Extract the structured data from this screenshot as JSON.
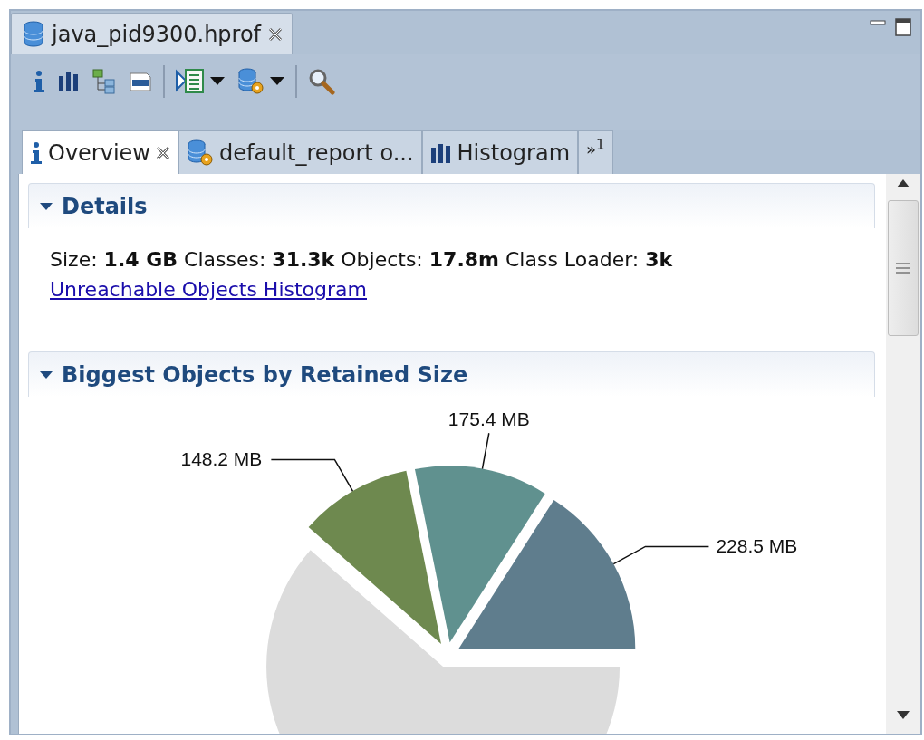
{
  "editor_tab": {
    "label": "java_pid9300.hprof"
  },
  "toolbar": [
    {
      "kind": "info"
    },
    {
      "kind": "histogram"
    },
    {
      "kind": "tree"
    },
    {
      "kind": "oql"
    },
    {
      "kind": "separator"
    },
    {
      "kind": "report",
      "dropdown": true
    },
    {
      "kind": "dbgear",
      "dropdown": true
    },
    {
      "kind": "separator"
    },
    {
      "kind": "search"
    }
  ],
  "tabs": [
    {
      "label": "Overview",
      "kind": "info",
      "selected": true,
      "closable": true
    },
    {
      "label": "default_report  o...",
      "kind": "dbgear",
      "selected": false,
      "closable": false
    },
    {
      "label": "Histogram",
      "kind": "histogram",
      "selected": false,
      "closable": false
    }
  ],
  "overflow": {
    "glyph": "»",
    "count": "1"
  },
  "sections": [
    {
      "title": "Details",
      "expanded": true,
      "kind": "details",
      "summary": "Size: **1.4 GB** Classes: **31.3k** Objects: **17.8m** Class Loader: **3k**",
      "link": "Unreachable Objects Histogram"
    },
    {
      "title": "Biggest Objects by Retained Size",
      "expanded": true,
      "kind": "chart",
      "chart_data": {
        "type": "pie",
        "values": [
          228.5,
          175.4,
          148.2,
          881.5
        ],
        "colors": [
          "#5f7d8d",
          "#60918f",
          "#6e894f",
          "#dcdcdc"
        ],
        "value_labels": [
          "228.5 MB",
          "175.4 MB",
          "148.2 MB",
          null
        ]
      }
    }
  ]
}
